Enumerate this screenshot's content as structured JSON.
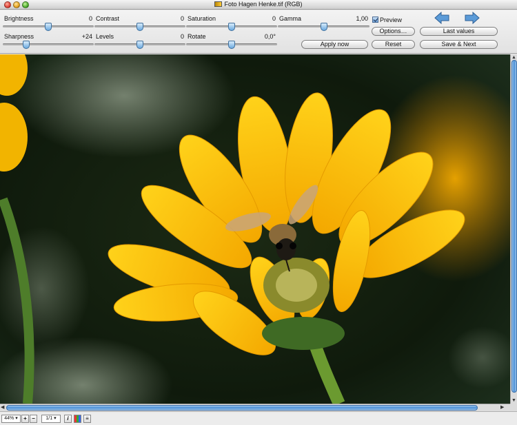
{
  "window": {
    "title": "Foto Hagen Henke.tif (RGB)"
  },
  "sliders": [
    {
      "label": "Brightness",
      "value": "0",
      "pos": 0.5
    },
    {
      "label": "Contrast",
      "value": "0",
      "pos": 0.5
    },
    {
      "label": "Saturation",
      "value": "0",
      "pos": 0.5
    },
    {
      "label": "Gamma",
      "value": "1,00",
      "pos": 0.5
    },
    {
      "label": "Sharpness",
      "value": "+24",
      "pos": 0.26
    },
    {
      "label": "Levels",
      "value": "0",
      "pos": 0.5
    },
    {
      "label": "Rotate",
      "value": "0,0°",
      "pos": 0.5
    }
  ],
  "controls": {
    "preview_label": "Preview",
    "preview_checked": true,
    "options_label": "Options…",
    "last_values_label": "Last values",
    "apply_label": "Apply now",
    "reset_label": "Reset",
    "save_next_label": "Save & Next",
    "back_icon": "arrow-left-icon",
    "forward_icon": "arrow-right-icon"
  },
  "status": {
    "zoom": "44%",
    "page": "1/1"
  },
  "colors": {
    "accent": "#4a8fd6",
    "arrow": "#5b9bd8"
  }
}
